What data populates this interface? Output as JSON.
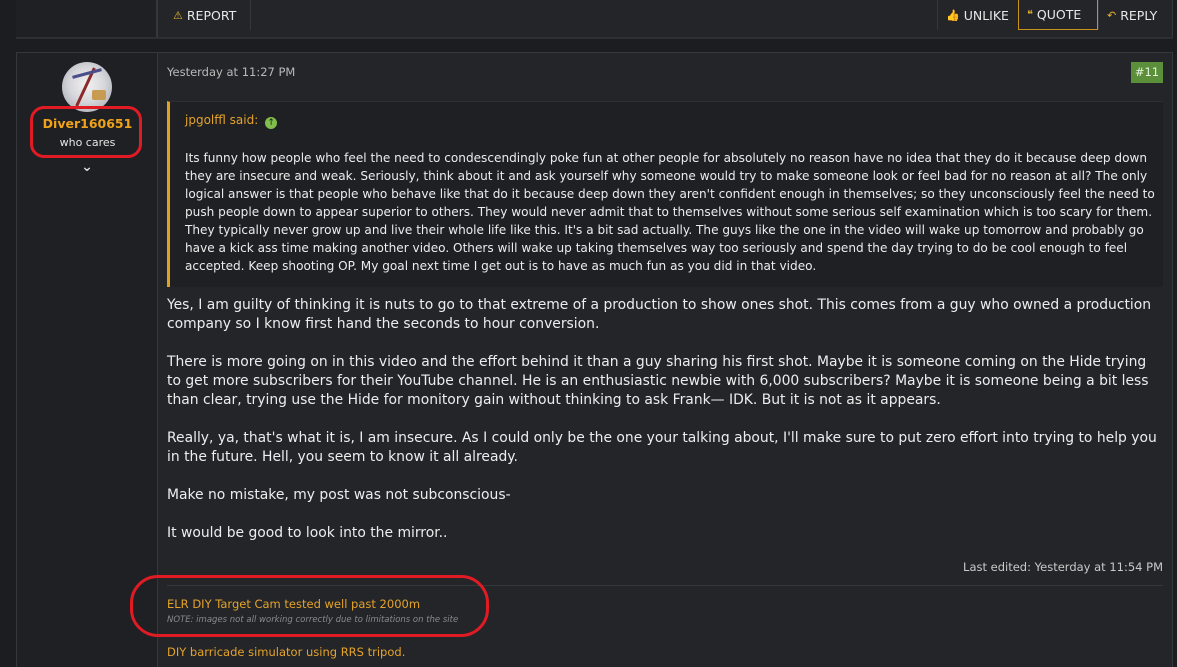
{
  "prev_post_actions": {
    "report_label": "REPORT",
    "unlike_label": "UNLIKE",
    "quote_label": "QUOTE",
    "reply_label": "REPLY"
  },
  "post": {
    "user": {
      "username": "Diver160651",
      "title": "who cares"
    },
    "date": "Yesterday at 11:27 PM",
    "number": "#11",
    "quote": {
      "author": "jpgolffl said:",
      "body": "Its funny how people who feel the need to condescendingly poke fun at other people for absolutely no reason have no idea that they do it because deep down they are insecure and weak. Seriously, think about it and ask yourself why someone would try to make someone look or feel bad for no reason at all? The only logical answer is that people who behave like that do it because deep down they aren't confident enough in themselves; so they unconsciously feel the need to push people down to appear superior to others. They would never admit that to themselves without some serious self examination which is too scary for them. They typically never grow up and live their whole life like this. It's a bit sad actually. The guys like the one in the video will wake up tomorrow and probably go have a kick ass time making another video. Others will wake up taking themselves way too seriously and spend the day trying to do be cool enough to feel accepted. Keep shooting OP. My goal next time I get out is to have as much fun as you did in that video."
    },
    "paragraphs": [
      "Yes, I am guilty of thinking it is nuts to go to that extreme of a production to show ones shot. This comes from a guy who owned a production company so I know first hand the seconds to hour conversion.",
      "There is more going on in this video and the effort behind it than a guy sharing his first shot. Maybe it is someone coming on the Hide trying to get more subscribers for their YouTube channel. He is an enthusiastic newbie with 6,000 subscribers? Maybe it is someone being a bit less than clear, trying use the Hide for monitory gain without thinking to ask Frank— IDK. But it is not as it appears.",
      "Really, ya, that's what it is, I am insecure. As I could only be the one your talking about, I'll make sure to put zero effort into trying to help you in the future. Hell, you seem to know it all already.",
      "Make no mistake, my post was not subconscious-",
      "It would be good to look into the mirror.."
    ],
    "last_edited": "Last edited: Yesterday at 11:54 PM",
    "signature": {
      "link1": "ELR DIY Target Cam tested well past 2000m",
      "note": "NOTE: images not all working correctly due to limitations on the site",
      "link2": "DIY barricade simulator using RRS tripod."
    }
  }
}
